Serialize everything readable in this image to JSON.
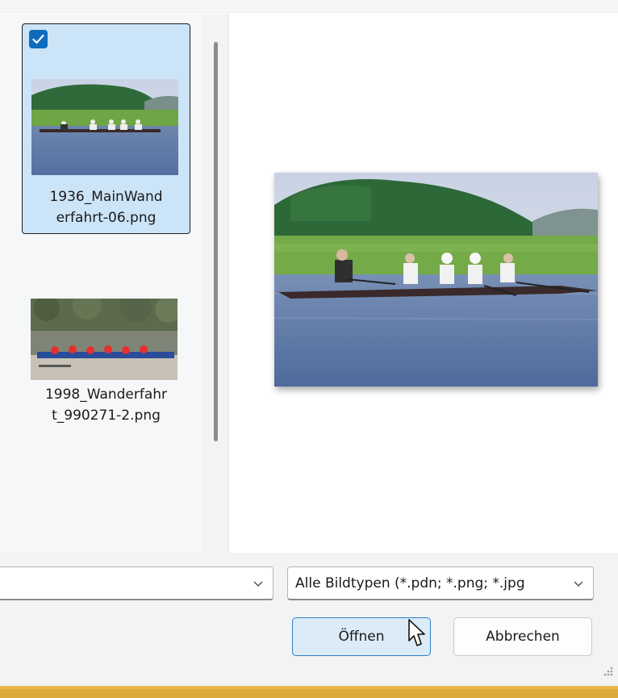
{
  "file_list": {
    "items": [
      {
        "name": "1936_MainWand\nerfahrt-06.png",
        "selected": true
      },
      {
        "name": "1998_Wanderfahr\nt_990271-2.png",
        "selected": false
      }
    ]
  },
  "footer": {
    "filename_value": "",
    "file_type_selected": "Alle Bildtypen (*.pdn; *.png; *.jpg",
    "open_label": "Öffnen",
    "cancel_label": "Abbrechen"
  },
  "colors": {
    "selection": "#cce4f7",
    "checkbox": "#0f6cbd",
    "accent": "#d9a93a"
  }
}
